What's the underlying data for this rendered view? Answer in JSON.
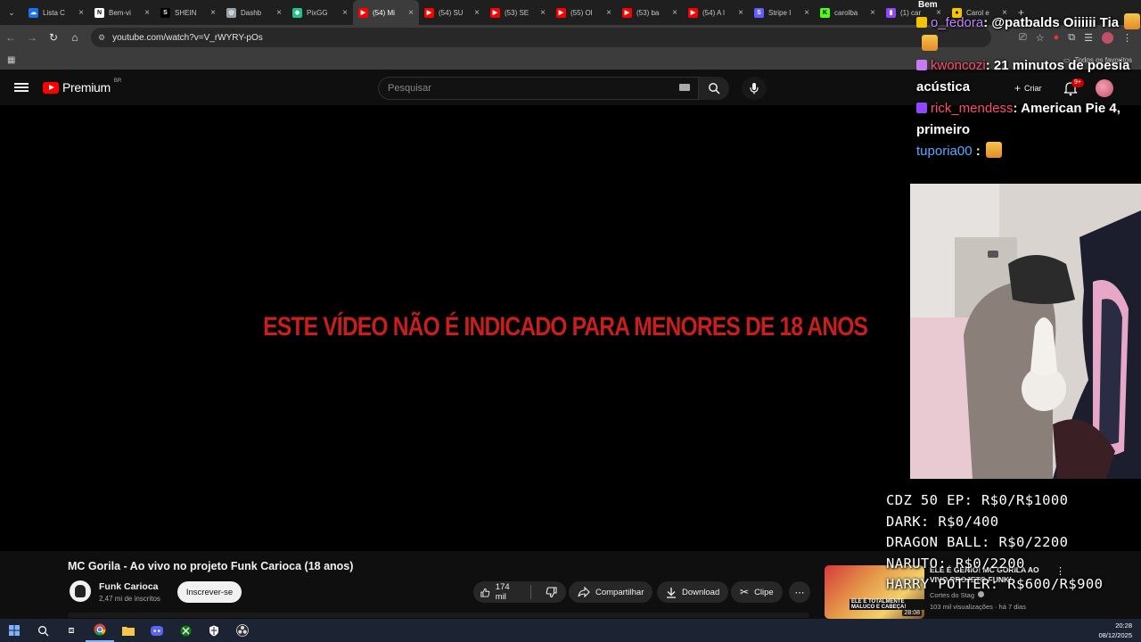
{
  "browser": {
    "tabs": [
      {
        "label": "Lista C",
        "color": "#1a73e8",
        "glyph": "☁"
      },
      {
        "label": "Bem-vi",
        "color": "#ffffff",
        "glyph": "N"
      },
      {
        "label": "SHEIN",
        "color": "#000000",
        "glyph": "S"
      },
      {
        "label": "Dashb",
        "color": "#9aa0a6",
        "glyph": "◎"
      },
      {
        "label": "PixGG",
        "color": "#1ec28b",
        "glyph": "◆"
      },
      {
        "label": "(54) Mi",
        "color": "#ff0000",
        "glyph": "▶",
        "active": true
      },
      {
        "label": "(54) SU",
        "color": "#ff0000",
        "glyph": "▶"
      },
      {
        "label": "(53) SE",
        "color": "#ff0000",
        "glyph": "▶"
      },
      {
        "label": "(55) Ol",
        "color": "#ff0000",
        "glyph": "▶"
      },
      {
        "label": "(53) ba",
        "color": "#ff0000",
        "glyph": "▶"
      },
      {
        "label": "(54) A l",
        "color": "#ff0000",
        "glyph": "▶"
      },
      {
        "label": "Stripe I",
        "color": "#635bff",
        "glyph": "S"
      },
      {
        "label": "carolba",
        "color": "#53fc18",
        "glyph": "K"
      },
      {
        "label": "(1) car",
        "color": "#9146ff",
        "glyph": "▮"
      },
      {
        "label": "Carol e",
        "color": "#f5c400",
        "glyph": "●"
      }
    ],
    "url": "youtube.com/watch?v=V_rWYRY-pOs",
    "all_bookmarks_label": "Todos os favoritos"
  },
  "youtube": {
    "logo_text": "Premium",
    "country_code": "BR",
    "search_placeholder": "Pesquisar",
    "create_label": "Criar",
    "notification_count": "9+",
    "video_warning": "ESTE VÍDEO NÃO É INDICADO PARA MENORES DE 18 ANOS",
    "video_title": "MC Gorila - Ao vivo no projeto Funk Carioca (18 anos)",
    "channel_name": "Funk Carioca",
    "channel_subscribers": "2,47 mi de inscritos",
    "subscribe_label": "Inscrever-se",
    "like_count": "174 mil",
    "share_label": "Compartilhar",
    "download_label": "Download",
    "clip_label": "Clipe",
    "recommended": {
      "title": "ELE É GENIO! MC GORILA AO VIVO PROJETO FUNK!",
      "channel": "Cortes do Stag",
      "meta": "103 mil visualizações · há 7 dias",
      "duration": "28:08",
      "thumb_text": "ELE É TOTALMENTE MALUCO E CABEÇA!"
    }
  },
  "overlay": {
    "peek_text": "Bem",
    "chat": [
      {
        "user": "o_fedora",
        "user_color": "#c084fc",
        "text": ": @patbalds Oiiiiii Tia",
        "badge": "#f5c400",
        "emotes": 2
      },
      {
        "user": "kwoncozi",
        "user_color": "#ff4d6d",
        "text": ": 21 minutos de poesia acústica",
        "badge": "#c97bf5",
        "emotes": 0
      },
      {
        "user": "rick_mendess",
        "user_color": "#ff4d6d",
        "text": ": American Pie 4, primeiro",
        "badge": "#9146ff",
        "emotes": 0
      },
      {
        "user": "tuporia00",
        "user_color": "#5aa9ff",
        "text": " :",
        "badge": "",
        "emotes": 1
      }
    ],
    "goals": [
      "CDZ 50 EP: R$0/R$1000",
      "DARK: R$0/400",
      "DRAGON BALL: R$0/2200",
      "NARUTO: R$0/2200",
      "HARRY POTTER: R$600/R$900"
    ]
  },
  "system": {
    "time": "20:28",
    "date": "08/12/2025"
  }
}
